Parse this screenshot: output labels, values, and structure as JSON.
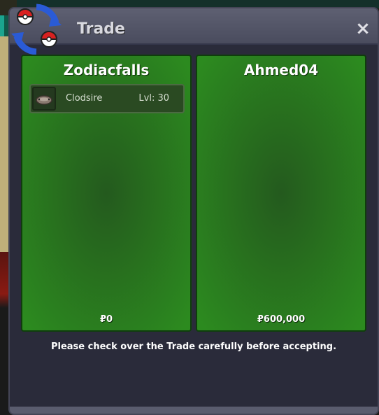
{
  "window": {
    "title": "Trade",
    "close_icon": "×"
  },
  "left_panel": {
    "trainer": "Zodiacfalls",
    "money": "₽0",
    "pokemon": [
      {
        "name": "Clodsire",
        "level": "Lvl: 30"
      }
    ]
  },
  "right_panel": {
    "trainer": "Ahmed04",
    "money": "₽600,000",
    "pokemon": []
  },
  "notice": "Please check over the Trade carefully before accepting.",
  "colors": {
    "panel_green": "#2c8a1f",
    "window_bg": "#2a2b3a",
    "titlebar": "#55576a"
  },
  "icons": {
    "trade": "pokeball-swap-icon"
  }
}
